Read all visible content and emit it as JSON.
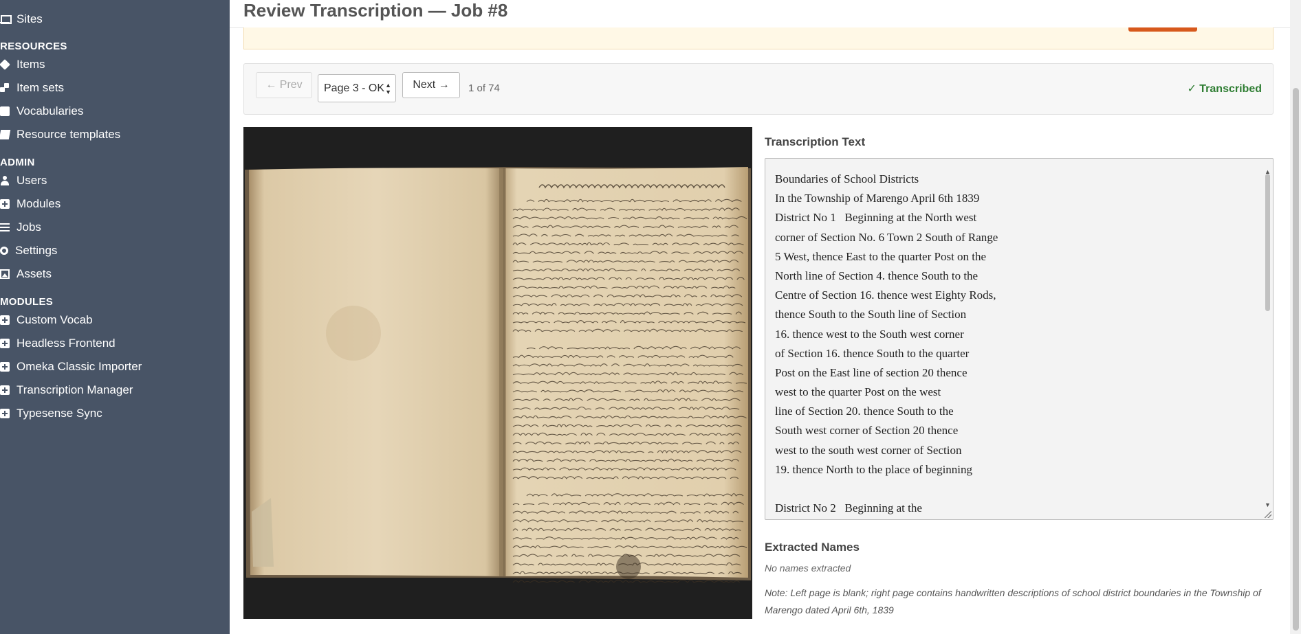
{
  "sidebar": {
    "top_items": [
      {
        "label": "Sites",
        "icon": "laptop-icon"
      }
    ],
    "sections": [
      {
        "heading": "RESOURCES",
        "items": [
          {
            "label": "Items",
            "icon": "cube-icon"
          },
          {
            "label": "Item sets",
            "icon": "cubes-icon"
          },
          {
            "label": "Vocabularies",
            "icon": "book-icon"
          },
          {
            "label": "Resource templates",
            "icon": "pencil-icon"
          }
        ]
      },
      {
        "heading": "ADMIN",
        "items": [
          {
            "label": "Users",
            "icon": "user-icon"
          },
          {
            "label": "Modules",
            "icon": "plus-square-icon"
          },
          {
            "label": "Jobs",
            "icon": "list-icon"
          },
          {
            "label": "Settings",
            "icon": "gears-icon"
          },
          {
            "label": "Assets",
            "icon": "image-icon"
          }
        ]
      },
      {
        "heading": "MODULES",
        "items": [
          {
            "label": "Custom Vocab",
            "icon": "plus-square-icon"
          },
          {
            "label": "Headless Frontend",
            "icon": "plus-square-icon"
          },
          {
            "label": "Omeka Classic Importer",
            "icon": "plus-square-icon"
          },
          {
            "label": "Transcription Manager",
            "icon": "plus-square-icon"
          },
          {
            "label": "Typesense Sync",
            "icon": "plus-square-icon"
          }
        ]
      }
    ]
  },
  "header": {
    "title": "Review Transcription — Job #8"
  },
  "toolbar": {
    "prev_label": "← Prev",
    "page_select_value": "Page 3 - OK",
    "next_label": "Next →",
    "page_count": "1 of 74",
    "status": "✓ Transcribed"
  },
  "transcription": {
    "label": "Transcription Text",
    "lines": [
      "Boundaries of School Districts",
      "In the Township of Marengo April 6th 1839",
      "District No 1   Beginning at the North west",
      "corner of Section No. 6 Town 2 South of Range",
      "5 West, thence East to the quarter Post on the",
      "North line of Section 4. thence South to the",
      "Centre of Section 16. thence west Eighty Rods,",
      "thence South to the South line of Section",
      "16. thence west to the South west corner",
      "of Section 16. thence South to the quarter",
      "Post on the East line of section 20 thence",
      "west to the quarter Post on the west",
      "line of Section 20. thence South to the",
      "South west corner of Section 20 thence",
      "west to the south west corner of Section",
      "19. thence North to the place of beginning",
      "",
      "District No 2   Beginning at the"
    ]
  },
  "names": {
    "label": "Extracted Names",
    "empty_text": "No names extracted"
  },
  "note": "Note: Left page is blank; right page contains handwritten descriptions of school district boundaries in the Township of Marengo dated April 6th, 1839",
  "colors": {
    "sidebar_bg": "#485466",
    "status_green": "#2e7d32",
    "alert_bg": "#fff8e6",
    "accent_orange": "#d7591c"
  }
}
